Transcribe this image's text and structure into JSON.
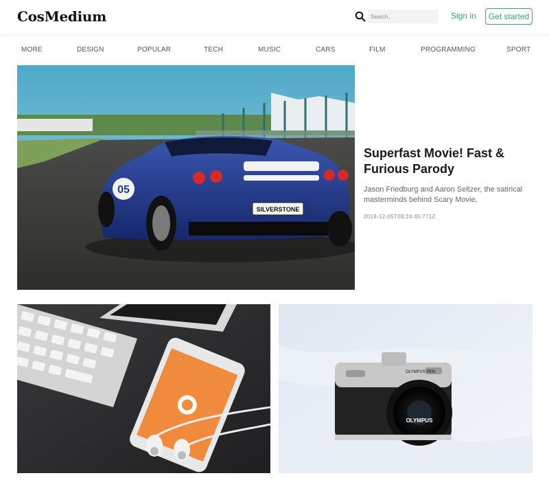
{
  "header": {
    "logo": "CosMedium",
    "search_placeholder": "Search..",
    "signin_label": "Sign in",
    "getstarted_label": "Get started"
  },
  "nav": {
    "items": [
      "MORE",
      "DESIGN",
      "POPULAR",
      "TECH",
      "MUSIC",
      "CARS",
      "FILM",
      "PROGRAMMING",
      "SPORT"
    ]
  },
  "featured": {
    "title": "Superfast Movie! Fast & Furious Parody",
    "description": "Jason Friedburg and Aaron Seltzer, the satirical masterminds behind Scary Movie,",
    "date": "2018-12-05T08:24:45.771Z",
    "plate_text": "SILVERSTONE",
    "car_number": "05"
  },
  "cards": [
    {
      "image": "phone-keyboard-earphones",
      "screen_text": ""
    },
    {
      "image": "olympus-camera",
      "brand_text": "OLYMPUS",
      "model_text": "OLYMPUS PEN"
    }
  ],
  "colors": {
    "accent": "#3aa57a",
    "car_blue": "#1f3a8a",
    "phone_screen": "#f08a3c"
  }
}
